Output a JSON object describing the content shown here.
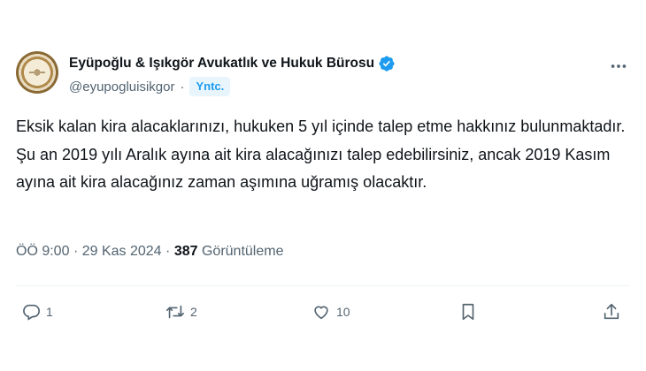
{
  "account": {
    "name": "Eyüpoğlu & Işıkgör Avukatlık ve Hukuk Bürosu",
    "handle": "@eyupogluisikgor",
    "separator": "·",
    "badge": "Yntc."
  },
  "tweet": {
    "text": "Eksik kalan kira alacaklarınızı, hukuken 5 yıl içinde talep etme hakkınız bulunmaktadır. Şu an 2019 yılı Aralık ayına ait kira alacağınızı talep edebilirsiniz, ancak 2019 Kasım ayına ait kira alacağınız zaman aşımına uğramış olacaktır.",
    "time": "ÖÖ 9:00",
    "date": "29 Kas 2024",
    "separator": "·",
    "views_count": "387",
    "views_label": "Görüntüleme"
  },
  "actions": {
    "reply_count": "1",
    "retweet_count": "2",
    "like_count": "10"
  },
  "colors": {
    "accent": "#1d9bf0",
    "muted": "#536471",
    "text": "#0f1419"
  },
  "icons": [
    "more-icon",
    "verified-icon",
    "reply-icon",
    "retweet-icon",
    "like-icon",
    "bookmark-icon",
    "share-icon"
  ]
}
